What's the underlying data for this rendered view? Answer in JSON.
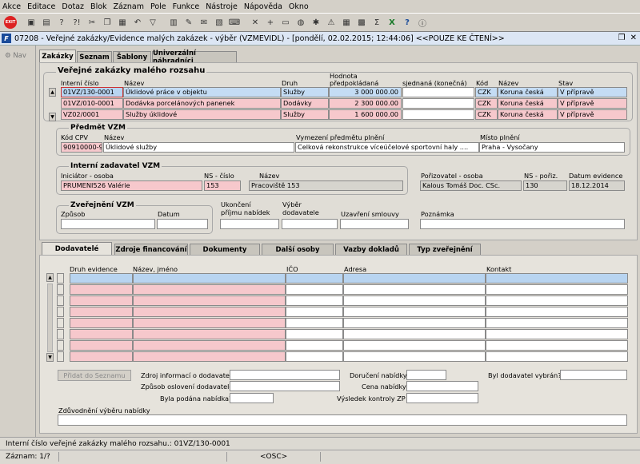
{
  "menu": [
    "Akce",
    "Editace",
    "Dotaz",
    "Blok",
    "Záznam",
    "Pole",
    "Funkce",
    "Nástroje",
    "Nápověda",
    "Okno"
  ],
  "window": {
    "title": "07208 - Veřejné zakázky/Evidence malých zakázek - výběr (VZMEVIDL) - [pondělí, 02.02.2015; 12:44:06] <<POUZE KE ČTENÍ>>"
  },
  "nav": {
    "label": "Nav"
  },
  "top_tabs": [
    "Zakázky",
    "Seznam",
    "Šablony",
    "Univerzální náhradníci"
  ],
  "vzmr": {
    "group_title": "Veřejné zakázky malého rozsahu",
    "headers": {
      "cislo": "Interní číslo",
      "nazev": "Název",
      "druh": "Druh",
      "hodnota1": "Hodnota",
      "hodnota2": "předpokládaná",
      "sjednana": "sjednaná (konečná)",
      "kod": "Kód",
      "mena": "Název",
      "stav": "Stav"
    },
    "rows": [
      {
        "cislo": "01VZ/130-0001",
        "nazev": "Úklidové práce v objektu",
        "druh": "Služby",
        "hodnota": "3 000 000.00",
        "sjednana": "",
        "kod": "CZK",
        "mena": "Koruna česká",
        "stav": "V přípravě"
      },
      {
        "cislo": "01VZ/010-0001",
        "nazev": "Dodávka porcelánových panenek",
        "druh": "Dodávky",
        "hodnota": "2 300 000.00",
        "sjednana": "",
        "kod": "CZK",
        "mena": "Koruna česká",
        "stav": "V přípravě"
      },
      {
        "cislo": "VZ02/0001",
        "nazev": "Služby úklidové",
        "druh": "Služby",
        "hodnota": "1 600 000.00",
        "sjednana": "",
        "kod": "CZK",
        "mena": "Koruna česká",
        "stav": "V přípravě"
      }
    ]
  },
  "predmet": {
    "title": "Předmět VZM",
    "kod_label": "Kód CPV",
    "nazev_label": "Název",
    "vymezeni_label": "Vymezení předmětu plnění",
    "misto_label": "Místo plnění",
    "kod": "90910000-9",
    "nazev": "Úklidové služby",
    "vymezeni": "Celková rekonstrukce víceúčelové sportovní haly ....",
    "misto": "Praha - Vysočany"
  },
  "zadavatel": {
    "title": "Interní zadavatel VZM",
    "iniciator_label": "Iniciátor - osoba",
    "ns_label": "NS - číslo",
    "nazev_label": "Název",
    "iniciator": "PRUMENI526 Valérie",
    "ns": "153",
    "nazev": "Pracoviště 153"
  },
  "porizovatel": {
    "osoba_label": "Pořizovatel - osoba",
    "ns_label": "NS - pořiz.",
    "datum_label": "Datum evidence",
    "osoba": "Kalous Tomáš Doc. CSc.",
    "ns": "130",
    "datum": "18.12.2014"
  },
  "zverejneni": {
    "title": "Zveřejnění VZM",
    "zpusob_label": "Způsob",
    "datum_label": "Datum"
  },
  "misc": {
    "ukonceni1": "Ukončení",
    "ukonceni2": "příjmu nabídek",
    "vyber1": "Výběr",
    "vyber2": "dodavatele",
    "uzavreni": "Uzavření smlouvy",
    "poznamka": "Poznámka"
  },
  "bottom_tabs": [
    "Dodavatelé",
    "Zdroje financování",
    "Dokumenty",
    "Další osoby",
    "Vazby dokladů",
    "Typ zveřejnění"
  ],
  "dodavatele": {
    "headers": {
      "druh": "Druh evidence",
      "nazev": "Název, jméno",
      "ico": "IČO",
      "adresa": "Adresa",
      "kontakt": "Kontakt"
    },
    "button": "Přidat do Seznamu",
    "zdroj": "Zdroj informací o dodavateli",
    "zpusob": "Způsob oslovení dodavatele",
    "podana": "Byla podána nabídka?",
    "doruceni": "Doručení nabídky",
    "cena": "Cena nabídky",
    "vysledek": "Výsledek kontroly ZP",
    "vybran": "Byl dodavatel vybrán?",
    "zduvodneni": "Zdůvodnění výběru nabídky"
  },
  "status": {
    "line1": "Interní číslo veřejné zakázky malého rozsahu.: 01VZ/130-0001",
    "zaznam": "Záznam: 1/?",
    "osc": "<OSC>"
  }
}
